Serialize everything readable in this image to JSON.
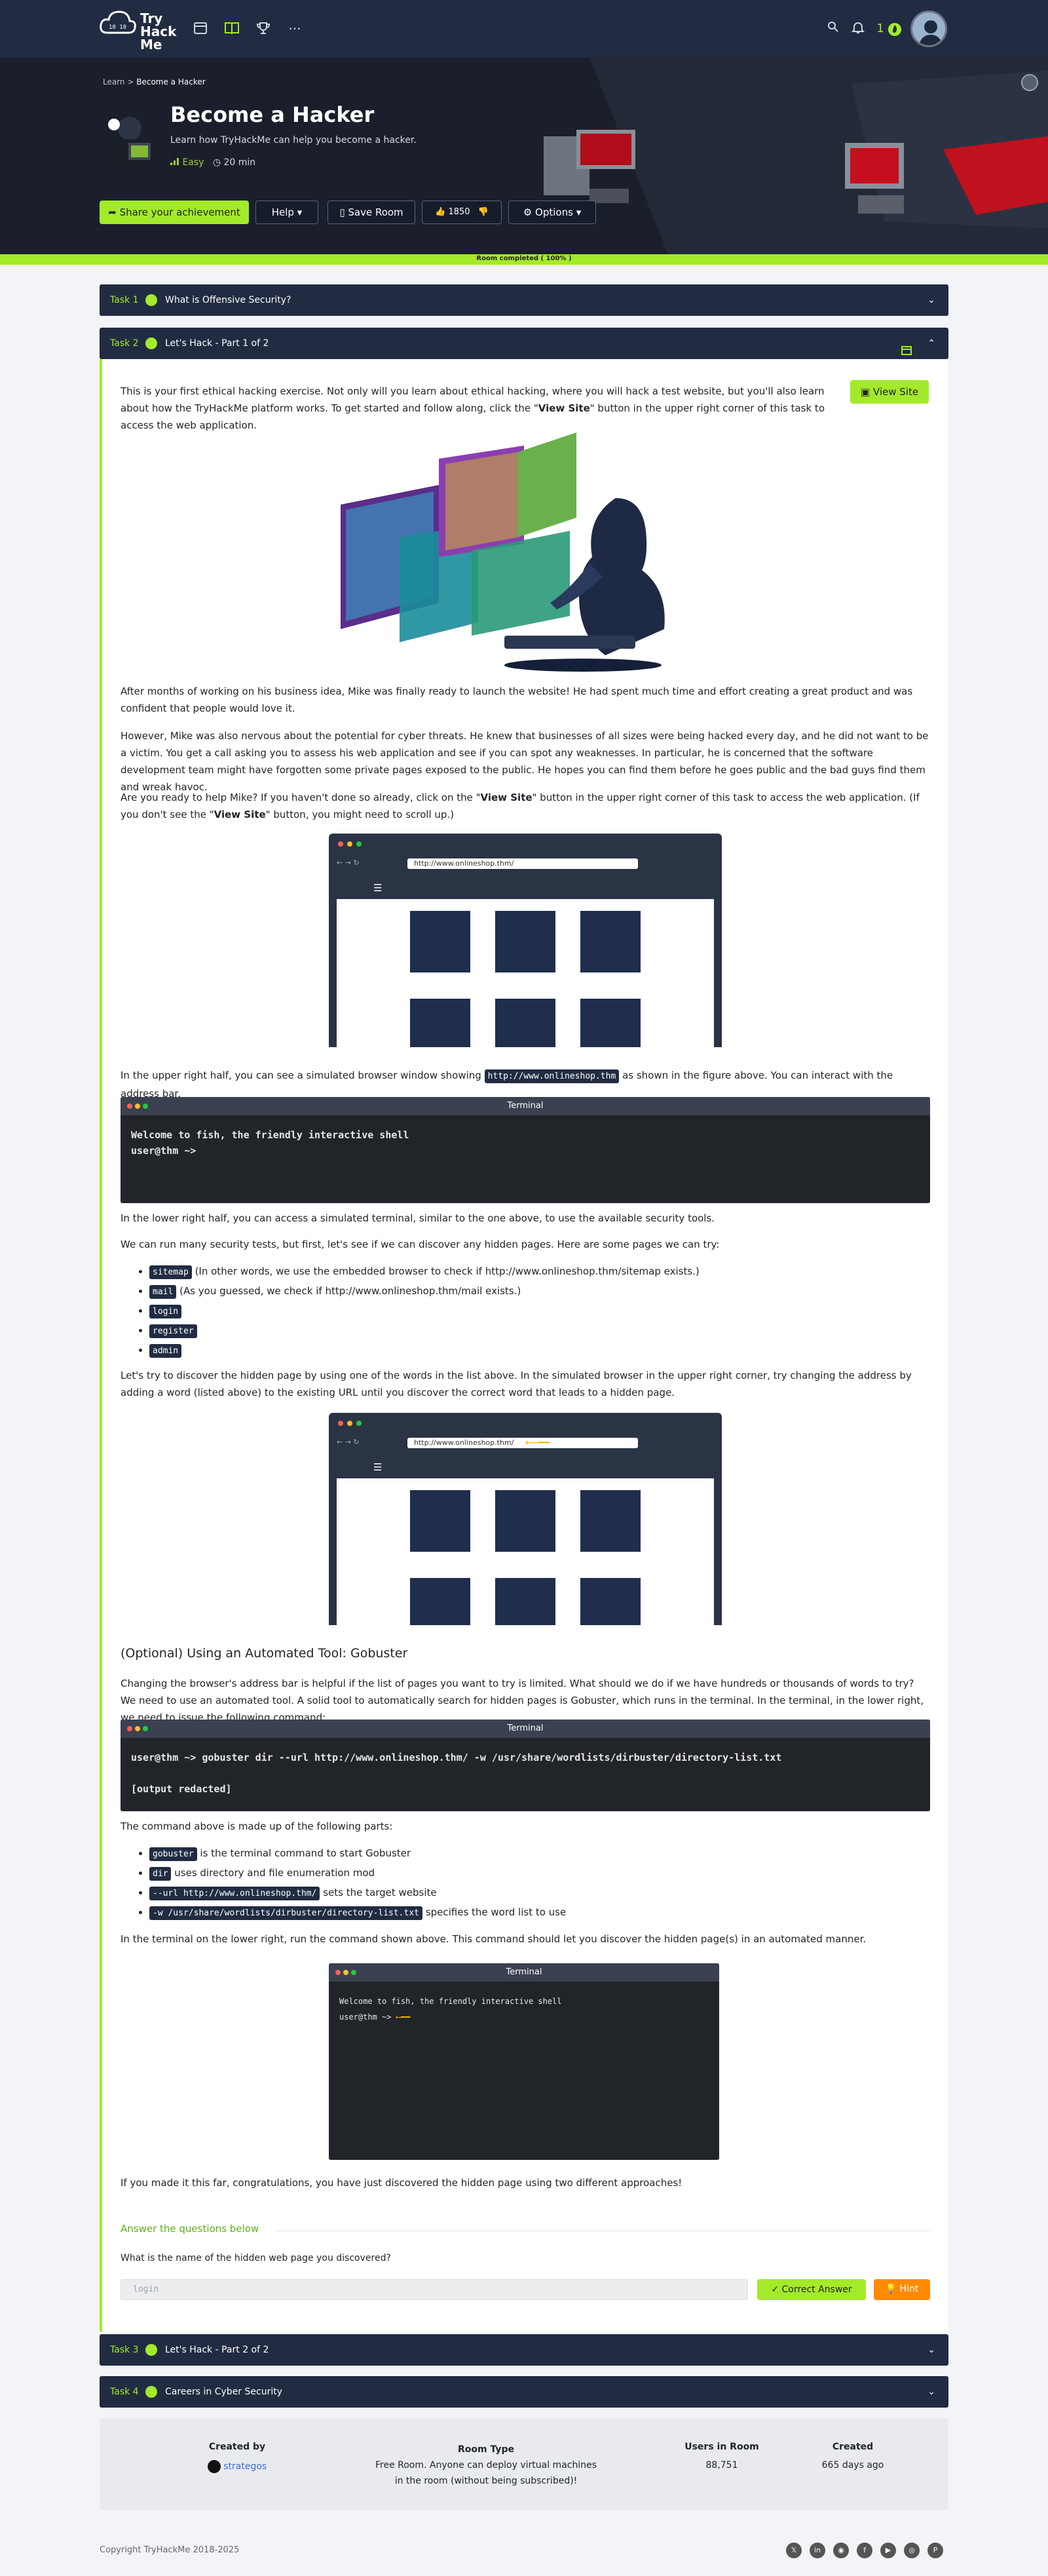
{
  "nav": {
    "logo_text": "TryHackMe",
    "streak": "1"
  },
  "hero": {
    "breadcrumb_learn": "Learn",
    "breadcrumb_current": "Become a Hacker",
    "title": "Become a Hacker",
    "description": "Learn how TryHackMe can help you become a hacker.",
    "difficulty": "Easy",
    "duration": "20 min",
    "share_label": "Share your achievement",
    "help_label": "Help",
    "save_label": "Save Room",
    "likes": "1850",
    "options_label": "Options"
  },
  "progress": {
    "label": "Room completed ( 100% )",
    "percent": 100
  },
  "tasks": [
    {
      "number": "Task 1",
      "title": "What is Offensive Security?"
    },
    {
      "number": "Task 2",
      "title": "Let's Hack - Part 1 of 2"
    },
    {
      "number": "Task 3",
      "title": "Let's Hack - Part 2 of 2"
    },
    {
      "number": "Task 4",
      "title": "Careers in Cyber Security"
    }
  ],
  "task2": {
    "view_site": "View Site",
    "intro_a": "This is your first ethical hacking exercise. Not only will you learn about ethical hacking, where you will hack a test website, but you'll also learn about how the TryHackMe platform works. To get started and follow along, click the \"",
    "intro_bold": "View Site",
    "intro_b": "\" button in the upper right corner of this task to access the web application.",
    "p1": "After months of working on his business idea, Mike was finally ready to launch the website! He had spent much time and effort creating a great product and was confident that people would love it.",
    "p2": "However, Mike was also nervous about the potential for cyber threats. He knew that businesses of all sizes were being hacked every day, and he did not want to be a victim. You get a call asking you to assess his web application and see if you can spot any weaknesses. In particular, he is concerned that the software development team might have forgotten some private pages exposed to the public. He hopes you can find them before he goes public and the bad guys find them and wreak havoc.",
    "p3_a": "Are you ready to help Mike? If you haven't done so already, click on the \"",
    "p3_bold1": "View Site",
    "p3_b": "\" button in the upper right corner of this task to access the web application. (If you don't see the \"",
    "p3_bold2": "View Site",
    "p3_c": "\" button, you might need to scroll up.)",
    "browser_url": "http://www.onlineshop.thm/",
    "p4_a": "In the upper right half, you can see a simulated browser window showing",
    "p4_code": "http://www.onlineshop.thm",
    "p4_b": "as shown in the figure above. You can interact with the address bar.",
    "terminal_title": "Terminal",
    "term1_line1": "Welcome to fish, the friendly interactive shell",
    "term1_line2": "user@thm ~>",
    "p5": "In the lower right half, you can access a simulated terminal, similar to the one above, to use the available security tools.",
    "p6": "We can run many security tests, but first, let's see if we can discover any hidden pages. Here are some pages we can try:",
    "pages": [
      {
        "code": "sitemap",
        "note": "(In other words, we use the embedded browser to check if http://www.onlineshop.thm/sitemap exists.)"
      },
      {
        "code": "mail",
        "note": "(As you guessed, we check if http://www.onlineshop.thm/mail exists.)"
      },
      {
        "code": "login",
        "note": ""
      },
      {
        "code": "register",
        "note": ""
      },
      {
        "code": "admin",
        "note": ""
      }
    ],
    "p7": "Let's try to discover the hidden page by using one of the words in the list above. In the simulated browser in the upper right corner, try changing the address by adding a word (listed above) to the existing URL until you discover the correct word that leads to a hidden page.",
    "heading_optional": "(Optional) Using an Automated Tool: Gobuster",
    "p8": "Changing the browser's address bar is helpful if the list of pages you want to try is limited. What should we do if we have hundreds or thousands of words to try? We need to use an automated tool. A solid tool to automatically search for hidden pages is Gobuster, which runs in the terminal. In the terminal, in the lower right, we need to issue the following command:",
    "term2_line1": "user@thm ~> gobuster dir --url http://www.onlineshop.thm/ -w /usr/share/wordlists/dirbuster/directory-list.txt",
    "term2_line2": "[output redacted]",
    "p9": "The command above is made up of the following parts:",
    "parts": [
      {
        "code": "gobuster",
        "note": "is the terminal command to start Gobuster"
      },
      {
        "code": "dir",
        "note": "uses directory and file enumeration mod"
      },
      {
        "code": "--url http://www.onlineshop.thm/",
        "note": "sets the target website"
      },
      {
        "code": "-w /usr/share/wordlists/dirbuster/directory-list.txt",
        "note": "specifies the word list to use"
      }
    ],
    "p10": "In the terminal on the lower right, run the command shown above. This command should let you discover the hidden page(s) in an automated manner.",
    "term3_line1": "Welcome to fish, the friendly interactive shell",
    "term3_line2": "user@thm ~>",
    "p11": "If you made it this far, congratulations, you have just discovered the hidden page using two different approaches!",
    "answer_heading": "Answer the questions below",
    "question": "What is the name of the hidden web page you discovered?",
    "answer_value": "login",
    "correct_label": "Correct Answer",
    "hint_label": "Hint"
  },
  "room_info": {
    "created_by_label": "Created by",
    "created_by": "strategos",
    "room_type_label": "Room Type",
    "room_type": "Free Room. Anyone can deploy virtual machines in the room (without being subscribed)!",
    "users_label": "Users in Room",
    "users": "88,751",
    "created_label": "Created",
    "created": "665 days ago"
  },
  "footer": {
    "copyright": "Copyright TryHackMe 2018-2025"
  },
  "colors": {
    "accent": "#a3ea2a",
    "navy": "#212c42",
    "hint": "#ff8a00"
  }
}
